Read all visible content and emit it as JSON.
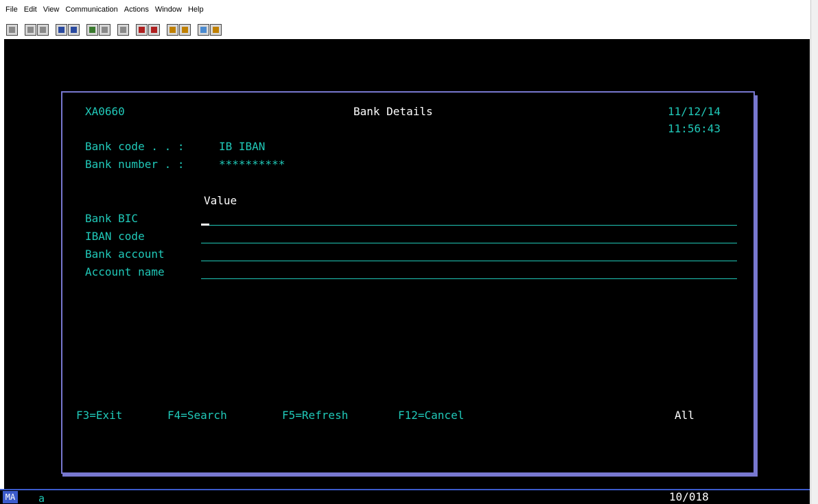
{
  "menu": [
    "File",
    "Edit",
    "View",
    "Communication",
    "Actions",
    "Window",
    "Help"
  ],
  "toolbar": {
    "icons": [
      "screen-icon",
      "copy-icon",
      "paste-icon",
      "send-icon",
      "receive-icon",
      "display-icon",
      "keypad-icon",
      "macro-icon",
      "record-icon",
      "play-icon",
      "transfer-icon",
      "download-icon",
      "globe-icon",
      "help-icon"
    ]
  },
  "screen": {
    "program_id": "XA0660",
    "title": "Bank Details",
    "date": "11/12/14",
    "time": "11:56:43",
    "bank_code_label": "Bank code . . :",
    "bank_code_value": "IB IBAN",
    "bank_number_label": "Bank number . :",
    "bank_number_value": "**********",
    "value_header": "Value",
    "fields": [
      {
        "label": "Bank BIC",
        "value": ""
      },
      {
        "label": "IBAN code",
        "value": ""
      },
      {
        "label": "Bank account",
        "value": ""
      },
      {
        "label": "Account name",
        "value": ""
      }
    ],
    "function_keys": [
      "F3=Exit",
      "F4=Search",
      "F5=Refresh",
      "F12=Cancel"
    ],
    "scope": "All"
  },
  "status": {
    "mode": "MA",
    "indicator": "a",
    "cursor_position": "10/018"
  },
  "colors": {
    "terminal_bg": "#000000",
    "field_text": "#20c8b8",
    "highlight_text": "#ffffff",
    "window_border": "#7878d0",
    "status_accent": "#3b5bcc"
  }
}
